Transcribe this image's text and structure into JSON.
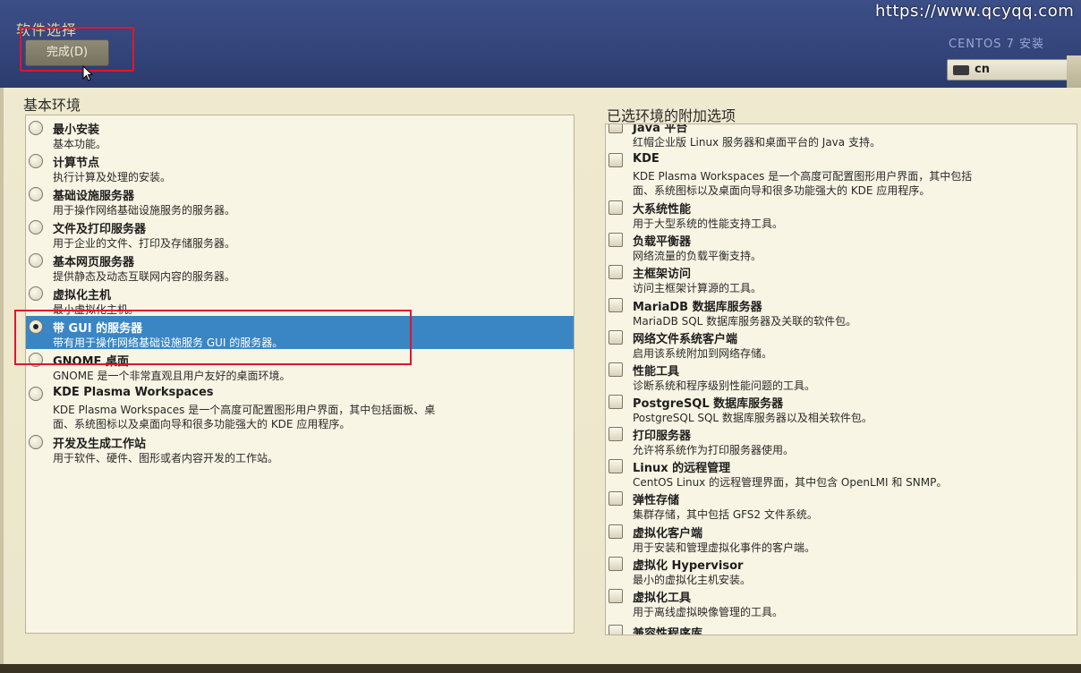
{
  "watermark": "https://www.qcyqq.com",
  "header": {
    "title": "软件选择",
    "done_button": "完成(D)",
    "product_title": "CENTOS 7 安装",
    "keyboard_layout": "cn"
  },
  "base_environment": {
    "title": "基本环境",
    "items": [
      {
        "name": "最小安装",
        "desc": "基本功能。",
        "selected": false
      },
      {
        "name": "计算节点",
        "desc": "执行计算及处理的安装。",
        "selected": false
      },
      {
        "name": "基础设施服务器",
        "desc": "用于操作网络基础设施服务的服务器。",
        "selected": false
      },
      {
        "name": "文件及打印服务器",
        "desc": "用于企业的文件、打印及存储服务器。",
        "selected": false
      },
      {
        "name": "基本网页服务器",
        "desc": "提供静态及动态互联网内容的服务器。",
        "selected": false
      },
      {
        "name": "虚拟化主机",
        "desc": "最小虚拟化主机。",
        "selected": false
      },
      {
        "name": "带 GUI 的服务器",
        "desc": "带有用于操作网络基础设施服务 GUI 的服务器。",
        "selected": true
      },
      {
        "name": "GNOME 桌面",
        "desc": "GNOME 是一个非常直观且用户友好的桌面环境。",
        "selected": false
      },
      {
        "name": "KDE Plasma Workspaces",
        "desc": "KDE Plasma Workspaces 是一个高度可配置图形用户界面，其中包括面板、桌",
        "desc2": "面、系统图标以及桌面向导和很多功能强大的 KDE 应用程序。",
        "selected": false
      },
      {
        "name": "开发及生成工作站",
        "desc": "用于软件、硬件、图形或者内容开发的工作站。",
        "selected": false
      }
    ]
  },
  "addons": {
    "title": "已选环境的附加选项",
    "items": [
      {
        "name": "Java 平台",
        "desc": "红帽企业版 Linux 服务器和桌面平台的 Java 支持。"
      },
      {
        "name": "KDE",
        "desc": "KDE Plasma Workspaces 是一个高度可配置图形用户界面，其中包括",
        "desc2": "面、系统图标以及桌面向导和很多功能强大的 KDE 应用程序。"
      },
      {
        "name": "大系统性能",
        "desc": "用于大型系统的性能支持工具。"
      },
      {
        "name": "负载平衡器",
        "desc": "网络流量的负载平衡支持。"
      },
      {
        "name": "主框架访问",
        "desc": "访问主框架计算源的工具。"
      },
      {
        "name": "MariaDB 数据库服务器",
        "desc": "MariaDB SQL 数据库服务器及关联的软件包。"
      },
      {
        "name": "网络文件系统客户端",
        "desc": "启用该系统附加到网络存储。"
      },
      {
        "name": "性能工具",
        "desc": "诊断系统和程序级别性能问题的工具。"
      },
      {
        "name": "PostgreSQL 数据库服务器",
        "desc": "PostgreSQL SQL 数据库服务器以及相关软件包。"
      },
      {
        "name": "打印服务器",
        "desc": "允许将系统作为打印服务器使用。"
      },
      {
        "name": "Linux 的远程管理",
        "desc": "CentOS Linux 的远程管理界面，其中包含 OpenLMI 和 SNMP。"
      },
      {
        "name": "弹性存储",
        "desc": "集群存储，其中包括 GFS2 文件系统。"
      },
      {
        "name": "虚拟化客户端",
        "desc": "用于安装和管理虚拟化事件的客户端。"
      },
      {
        "name": "虚拟化 Hypervisor",
        "desc": "最小的虚拟化主机安装。"
      },
      {
        "name": "虚拟化工具",
        "desc": "用于离线虚拟映像管理的工具。"
      },
      {
        "name": "兼容性程序库",
        "desc": ""
      }
    ]
  }
}
